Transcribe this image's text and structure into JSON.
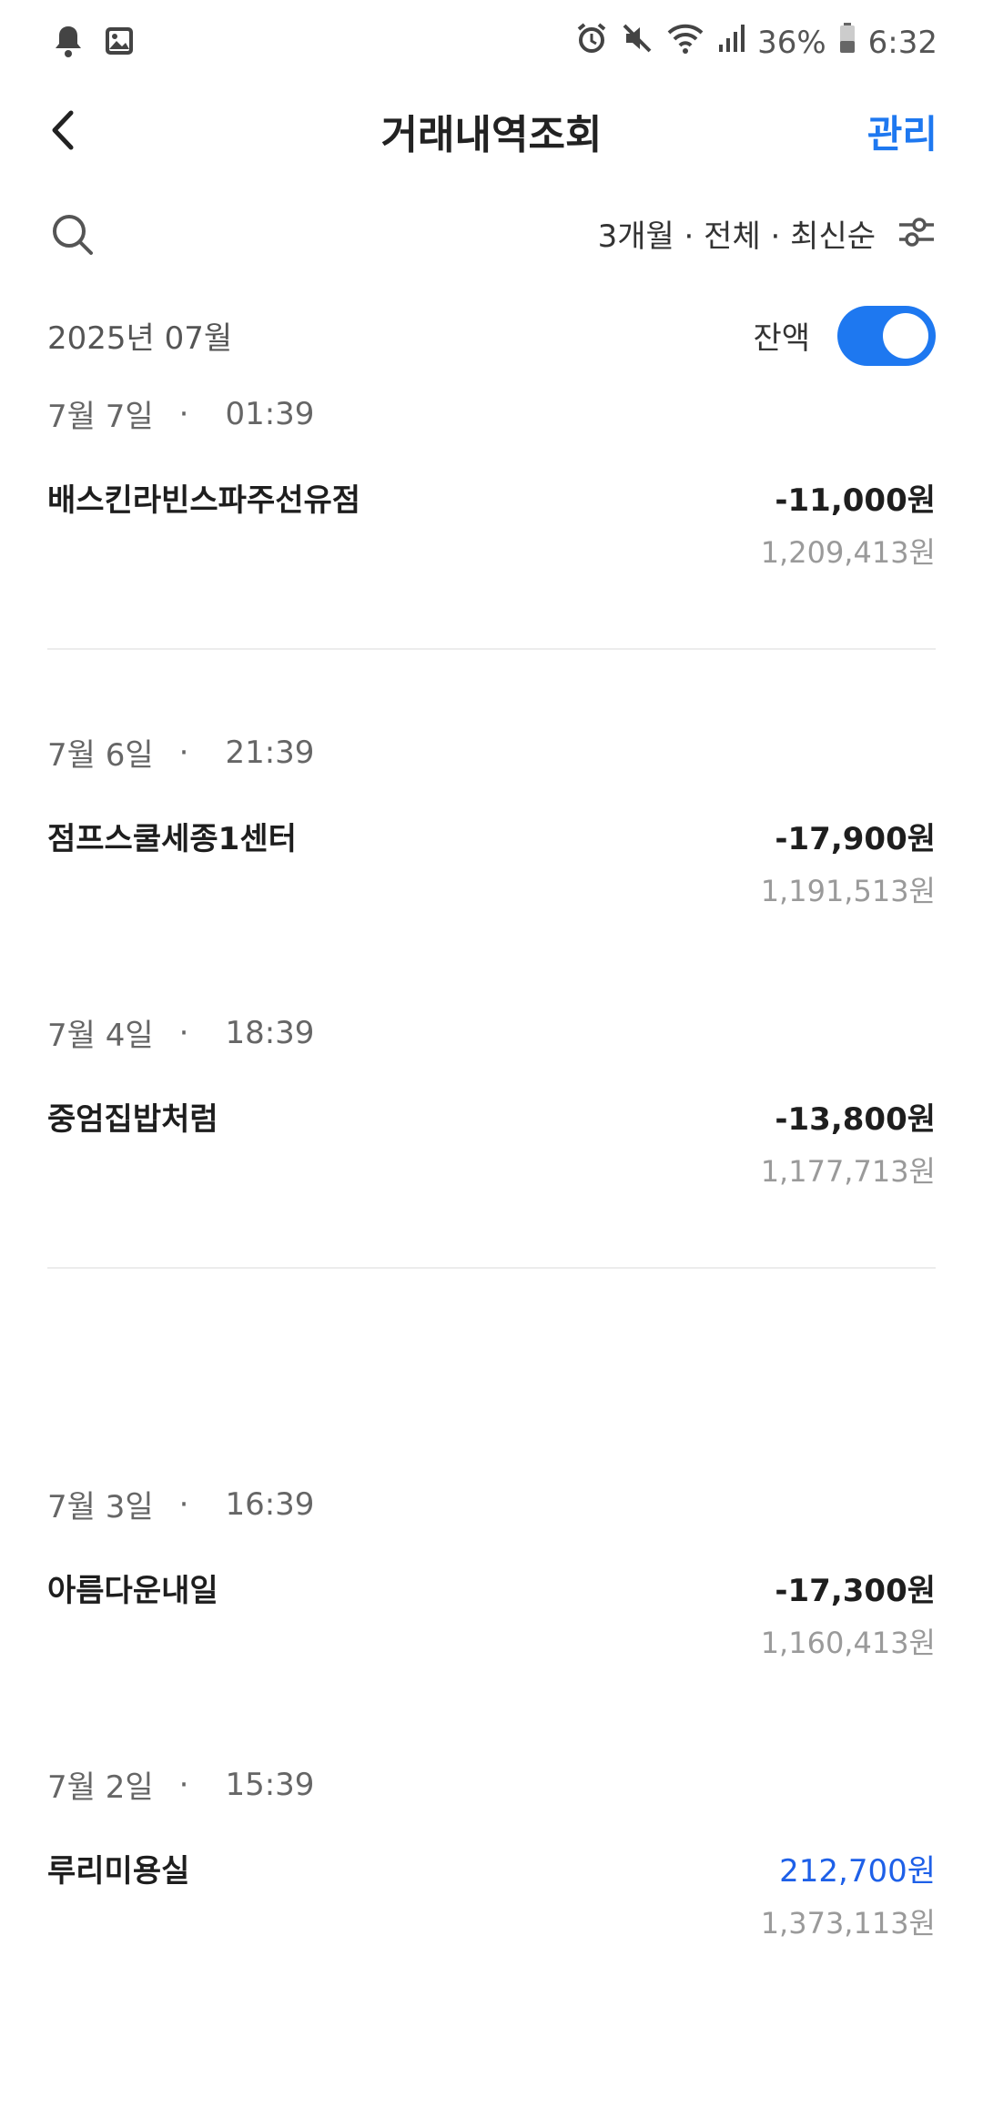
{
  "status_bar": {
    "battery": "36%",
    "time": "6:32"
  },
  "header": {
    "title": "거래내역조회",
    "manage_label": "관리"
  },
  "toolbar": {
    "filter_label": "3개월 · 전체 · 최신순"
  },
  "month_row": {
    "month": "2025년 07월",
    "balance_label": "잔액",
    "balance_toggle_on": true
  },
  "transactions": [
    {
      "date": "7월 7일",
      "time": "01:39",
      "name": "배스킨라빈스파주선유점",
      "amount": "-11,000원",
      "balance": "1,209,413원"
    },
    {
      "date": "7월 6일",
      "time": "21:39",
      "name": "점프스쿨세종1센터",
      "amount": "-17,900원",
      "balance": "1,191,513원"
    },
    {
      "date": "7월 4일",
      "time": "18:39",
      "name": "중엄집밥처럼",
      "amount": "-13,800원",
      "balance": "1,177,713원"
    },
    {
      "date": "7월 3일",
      "time": "16:39",
      "name": "아름다운내일",
      "amount": "-17,300원",
      "balance": "1,160,413원"
    },
    {
      "date": "7월 2일",
      "time": "15:39",
      "name": "루리미용실",
      "amount": "212,700원",
      "balance": "1,373,113원"
    }
  ],
  "icons": {
    "notification": "bell-icon",
    "gallery": "image-icon",
    "alarm": "alarm-icon",
    "mute": "mute-icon",
    "wifi": "wifi-icon",
    "signal": "signal-icon",
    "battery": "battery-icon",
    "back": "chevron-left-icon",
    "search": "search-icon",
    "filter": "sliders-icon"
  },
  "colors": {
    "accent": "#1e78f0",
    "deposit": "#1e60e8",
    "muted": "#9a9a9a"
  }
}
